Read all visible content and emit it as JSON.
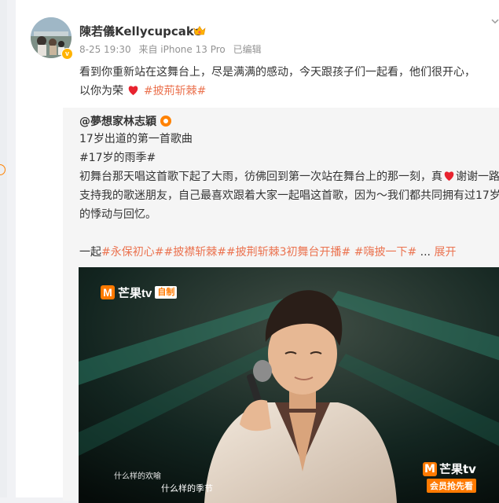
{
  "post": {
    "username": "陳若儀Kellycupcake",
    "date": "8-25 19:30",
    "source": "来自 iPhone 13 Pro",
    "edited": "已编辑",
    "text_line1": "看到你重新站在这舞台上，尽是满满的感动，今天跟孩子们一起看，他们很开心，",
    "text_line2_prefix": "以你为荣",
    "topic": "#披荊斩棘#"
  },
  "repost": {
    "author": "@夢想家林志穎",
    "line1": "17岁出道的第一首歌曲",
    "topic1": "#17岁的雨季#",
    "line3_a": "初舞台那天唱这首歌下起了大雨，彷佛回到第一次站在舞台上的那一刻，真",
    "line3_b": "谢谢一路",
    "line4": "支持我的歌迷朋友，自己最喜欢跟着大家一起唱这首歌，因为～我们都共同拥有过17岁",
    "line5": "的悸动与回忆。",
    "tags_prefix": "一起",
    "tags": "#永保初心##披襟斩棘##披荆斩棘3初舞台开播# #嗨披一下#",
    "ellipsis": " ...",
    "expand": "展开"
  },
  "video": {
    "logo_name": "芒果tv",
    "logo_tag": "自制",
    "logo_br_tag": "会员抢先看",
    "subtitle_small": "什么样的欢喻",
    "subtitle_main": "什么样的季节"
  },
  "colors": {
    "topic": "#eb7350",
    "accent": "#ff8200",
    "mango": "#ff7a00"
  }
}
